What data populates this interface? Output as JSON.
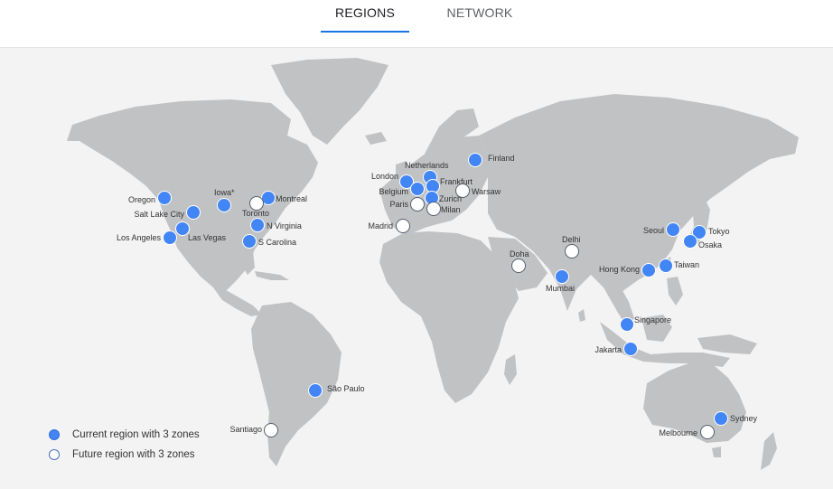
{
  "tabs": {
    "regions": "REGIONS",
    "network": "NETWORK",
    "active": "regions"
  },
  "colors": {
    "land": "#c0c2c4",
    "ocean": "#f3f3f3",
    "current_region": "#4285f4",
    "future_region": "#ffffff",
    "accent": "#1a73e8"
  },
  "legend": {
    "current": "Current region with 3 zones",
    "future": "Future region with 3 zones"
  },
  "regions": [
    {
      "name": "Oregon",
      "status": "current"
    },
    {
      "name": "Salt Lake City",
      "status": "current"
    },
    {
      "name": "Los Angeles",
      "status": "current"
    },
    {
      "name": "Las Vegas",
      "status": "current"
    },
    {
      "name": "Iowa*",
      "status": "current"
    },
    {
      "name": "Montreal",
      "status": "current"
    },
    {
      "name": "Toronto",
      "status": "future"
    },
    {
      "name": "N Virginia",
      "status": "current"
    },
    {
      "name": "S Carolina",
      "status": "current"
    },
    {
      "name": "São Paulo",
      "status": "current"
    },
    {
      "name": "Santiago",
      "status": "future"
    },
    {
      "name": "London",
      "status": "current"
    },
    {
      "name": "Netherlands",
      "status": "current"
    },
    {
      "name": "Belgium",
      "status": "current"
    },
    {
      "name": "Frankfurt",
      "status": "current"
    },
    {
      "name": "Paris",
      "status": "future"
    },
    {
      "name": "Zurich",
      "status": "current"
    },
    {
      "name": "Milan",
      "status": "future"
    },
    {
      "name": "Warsaw",
      "status": "future"
    },
    {
      "name": "Madrid",
      "status": "future"
    },
    {
      "name": "Finland",
      "status": "current"
    },
    {
      "name": "Doha",
      "status": "future"
    },
    {
      "name": "Delhi",
      "status": "future"
    },
    {
      "name": "Mumbai",
      "status": "current"
    },
    {
      "name": "Hong Kong",
      "status": "current"
    },
    {
      "name": "Taiwan",
      "status": "current"
    },
    {
      "name": "Seoul",
      "status": "current"
    },
    {
      "name": "Tokyo",
      "status": "current"
    },
    {
      "name": "Osaka",
      "status": "current"
    },
    {
      "name": "Singapore",
      "status": "current"
    },
    {
      "name": "Jakarta",
      "status": "current"
    },
    {
      "name": "Sydney",
      "status": "current"
    },
    {
      "name": "Melbourne",
      "status": "future"
    }
  ]
}
